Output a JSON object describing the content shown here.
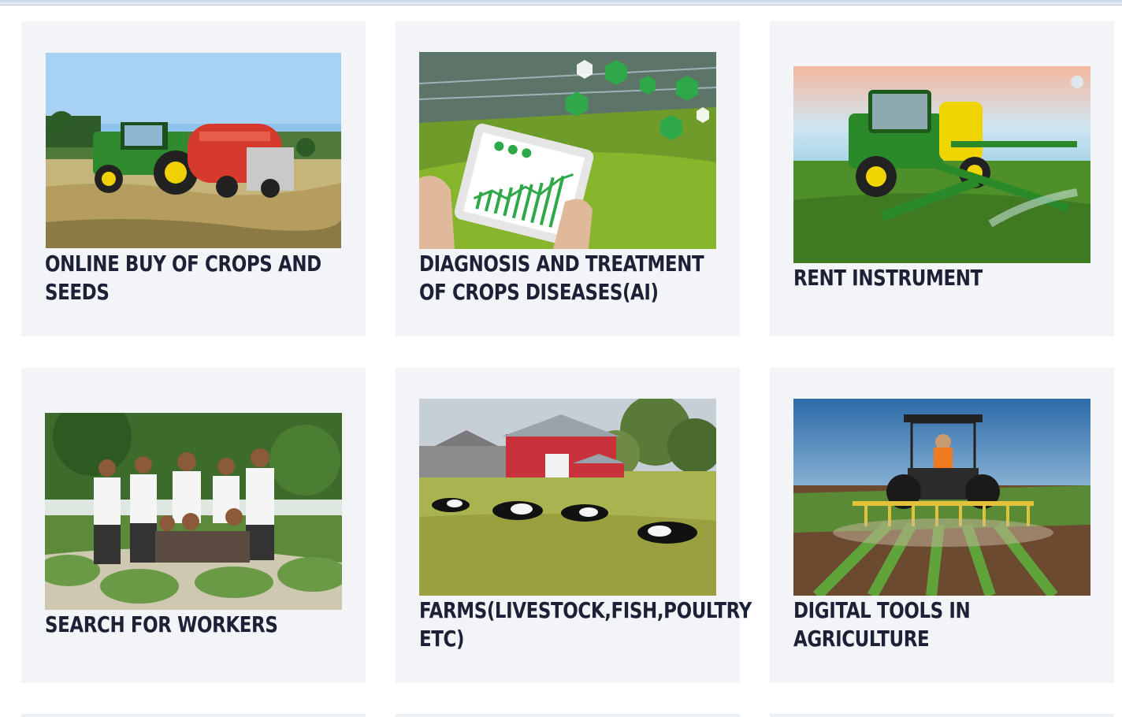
{
  "cards": [
    {
      "title": "ONLINE BUY OF CROPS AND SEEDS",
      "image_icon": "tractor-baler-field-icon"
    },
    {
      "title": "DIAGNOSIS AND TREATMENT OF CROPS DISEASES(AI)",
      "image_icon": "tablet-greenhouse-icon"
    },
    {
      "title": "RENT INSTRUMENT",
      "image_icon": "sprayer-tractor-icon"
    },
    {
      "title": "SEARCH FOR WORKERS",
      "image_icon": "workers-group-icon"
    },
    {
      "title": "FARMS(LIVESTOCK,FISH,POULTRY ETC)",
      "image_icon": "barn-cows-icon"
    },
    {
      "title": "DIGITAL TOOLS IN AGRICULTURE",
      "image_icon": "tractor-rows-icon"
    }
  ],
  "colors": {
    "card_bg": "#f2f4f8",
    "title": "#1d2136"
  }
}
